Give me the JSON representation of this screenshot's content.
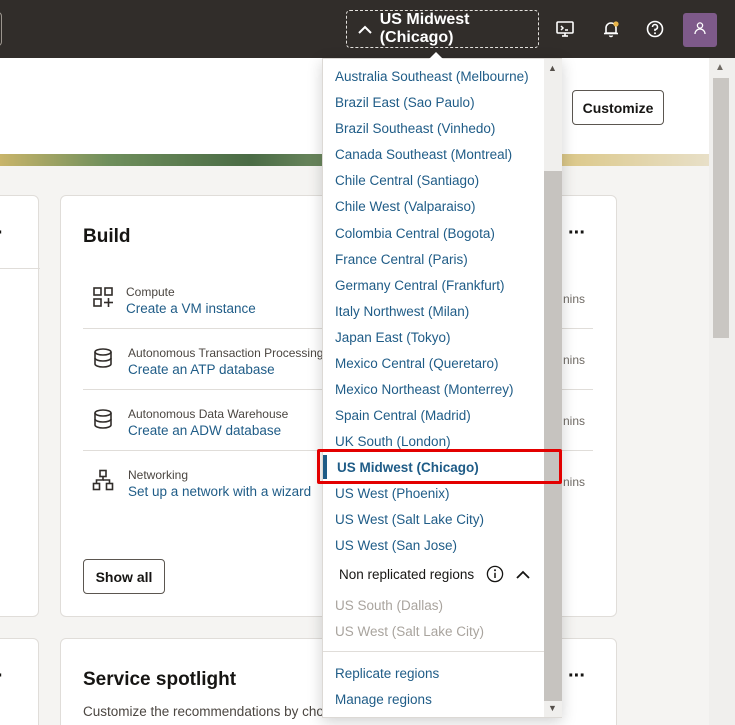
{
  "header": {
    "current_region": "US Midwest (Chicago)",
    "icons": [
      "cloud-shell-icon",
      "bell-icon",
      "help-icon",
      "user-icon"
    ]
  },
  "banner": {
    "customize_label": "Customize"
  },
  "build_card": {
    "title": "Build",
    "items": [
      {
        "category": "Compute",
        "link": "Create a VM instance",
        "icon": "compute-icon"
      },
      {
        "category": "Autonomous Transaction Processing",
        "link": "Create an ATP database",
        "icon": "database-icon"
      },
      {
        "category": "Autonomous Data Warehouse",
        "link": "Create an ADW database",
        "icon": "database-icon"
      },
      {
        "category": "Networking",
        "link": "Set up a network with a wizard",
        "icon": "network-icon"
      }
    ],
    "show_all_label": "Show all",
    "mins_text": "nins"
  },
  "spotlight_card": {
    "title": "Service spotlight",
    "text": "Customize the recommendations by choo"
  },
  "region_dropdown": {
    "regions": [
      "Australia Southeast (Melbourne)",
      "Brazil East (Sao Paulo)",
      "Brazil Southeast (Vinhedo)",
      "Canada Southeast (Montreal)",
      "Chile Central (Santiago)",
      "Chile West (Valparaiso)",
      "Colombia Central (Bogota)",
      "France Central (Paris)",
      "Germany Central (Frankfurt)",
      "Italy Northwest (Milan)",
      "Japan East (Tokyo)",
      "Mexico Central (Queretaro)",
      "Mexico Northeast (Monterrey)",
      "Spain Central (Madrid)",
      "UK South (London)",
      "US Midwest (Chicago)",
      "US West (Phoenix)",
      "US West (Salt Lake City)",
      "US West (San Jose)"
    ],
    "selected_index": 15,
    "non_replicated_label": "Non replicated regions",
    "non_replicated": [
      "US South (Dallas)",
      "US West (Salt Lake City)"
    ],
    "footer_links": [
      "Replicate regions",
      "Manage regions"
    ]
  },
  "colors": {
    "header_bg": "#312d2a",
    "link": "#1f5c87",
    "highlight": "#e30000",
    "avatar": "#7e5a8a"
  }
}
